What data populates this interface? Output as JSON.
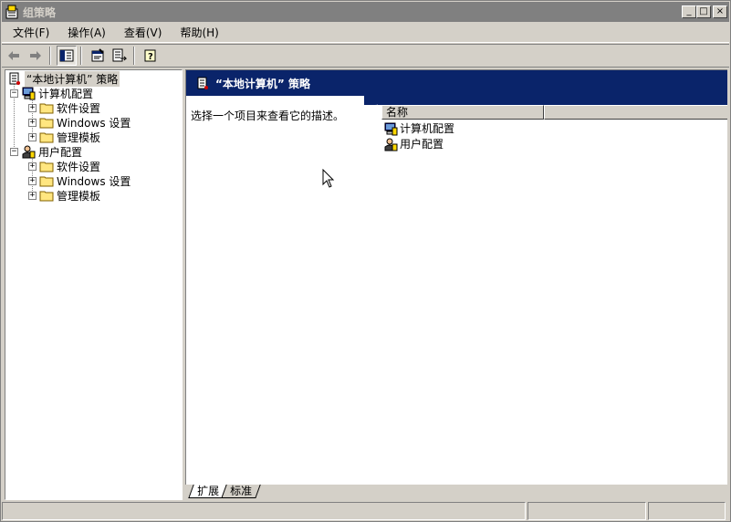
{
  "window": {
    "title": "组策略",
    "minimize_glyph": "_",
    "maximize_glyph": "□",
    "close_glyph": "×"
  },
  "menu": [
    {
      "label": "文件(F)"
    },
    {
      "label": "操作(A)"
    },
    {
      "label": "查看(V)"
    },
    {
      "label": "帮助(H)"
    }
  ],
  "toolbar": {
    "icons": [
      "back-arrow-icon",
      "forward-arrow-icon",
      "show-hide-tree-icon",
      "properties-icon",
      "export-list-icon",
      "help-icon"
    ]
  },
  "tree": {
    "root": {
      "label": "“本地计算机” 策略",
      "icon": "policy-scroll-icon"
    },
    "computer": {
      "label": "计算机配置",
      "icon": "computer-icon"
    },
    "computer_children": [
      {
        "label": "软件设置"
      },
      {
        "label": "Windows 设置"
      },
      {
        "label": "管理模板"
      }
    ],
    "user": {
      "label": "用户配置",
      "icon": "user-icon"
    },
    "user_children": [
      {
        "label": "软件设置"
      },
      {
        "label": "Windows 设置"
      },
      {
        "label": "管理模板"
      }
    ]
  },
  "details": {
    "header_title": "“本地计算机” 策略",
    "description": "选择一个项目来查看它的描述。",
    "column_name": "名称",
    "items": [
      {
        "label": "计算机配置",
        "icon": "computer-icon"
      },
      {
        "label": "用户配置",
        "icon": "user-icon"
      }
    ]
  },
  "bottom_tabs": [
    {
      "label": "扩展"
    },
    {
      "label": "标准"
    }
  ],
  "colors": {
    "header_bg": "#0a246a",
    "titlebar_inactive": "#808080",
    "face": "#d4d0c8"
  }
}
